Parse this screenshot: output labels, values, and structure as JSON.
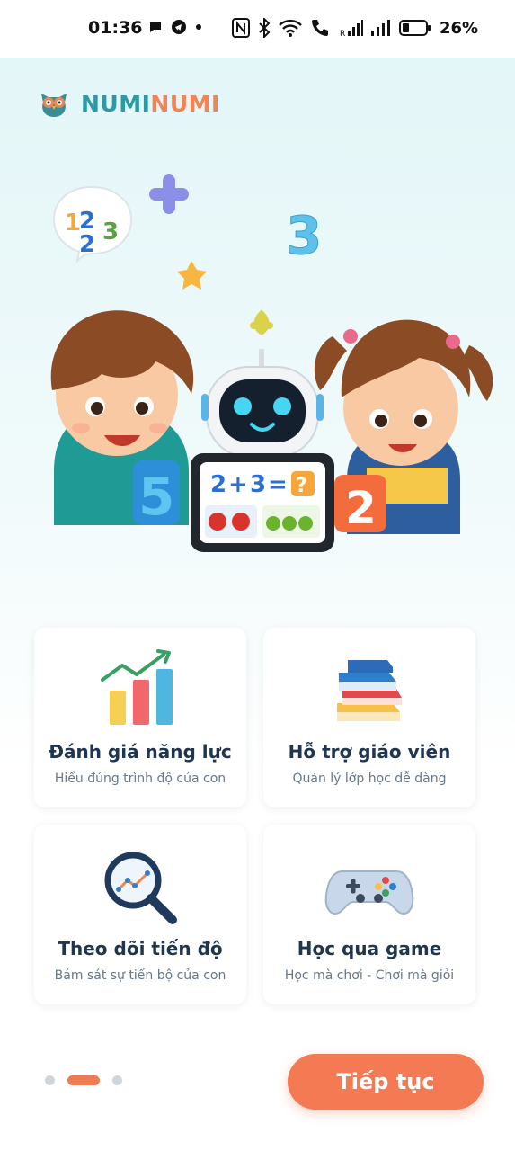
{
  "status_bar": {
    "time": "01:36",
    "battery": "26%",
    "icons": [
      "chat-icon",
      "telegram-icon",
      "dot-icon",
      "nfc-icon",
      "bluetooth-icon",
      "wifi-icon",
      "call-icon",
      "signal-icon",
      "signal-icon",
      "battery-icon"
    ]
  },
  "logo": {
    "part1": "NUMI",
    "part2": "NUMI"
  },
  "hero": {
    "bubble_digits": [
      "1",
      "2",
      "3",
      "2"
    ],
    "floating_number": "3",
    "tablet_equation": [
      "2",
      "+",
      "3",
      "=",
      "?"
    ],
    "left_card_number": "5",
    "right_card_number": "2"
  },
  "features": [
    {
      "title": "Đánh giá năng lực",
      "subtitle": "Hiểu đúng trình độ của con",
      "icon": "bar-chart-icon"
    },
    {
      "title": "Hỗ trợ giáo viên",
      "subtitle": "Quản lý lớp học dễ dàng",
      "icon": "books-icon"
    },
    {
      "title": "Theo dõi tiến độ",
      "subtitle": "Bám sát sự tiến bộ của con",
      "icon": "magnifier-chart-icon"
    },
    {
      "title": "Học qua game",
      "subtitle": "Học mà chơi - Chơi mà giỏi",
      "icon": "gamepad-icon"
    }
  ],
  "pagination": {
    "current": 2,
    "total": 3
  },
  "next_button": {
    "label": "Tiếp tục"
  },
  "colors": {
    "accent": "#F47A54",
    "brand_teal": "#2B9AA3",
    "title_navy": "#1F3550"
  }
}
